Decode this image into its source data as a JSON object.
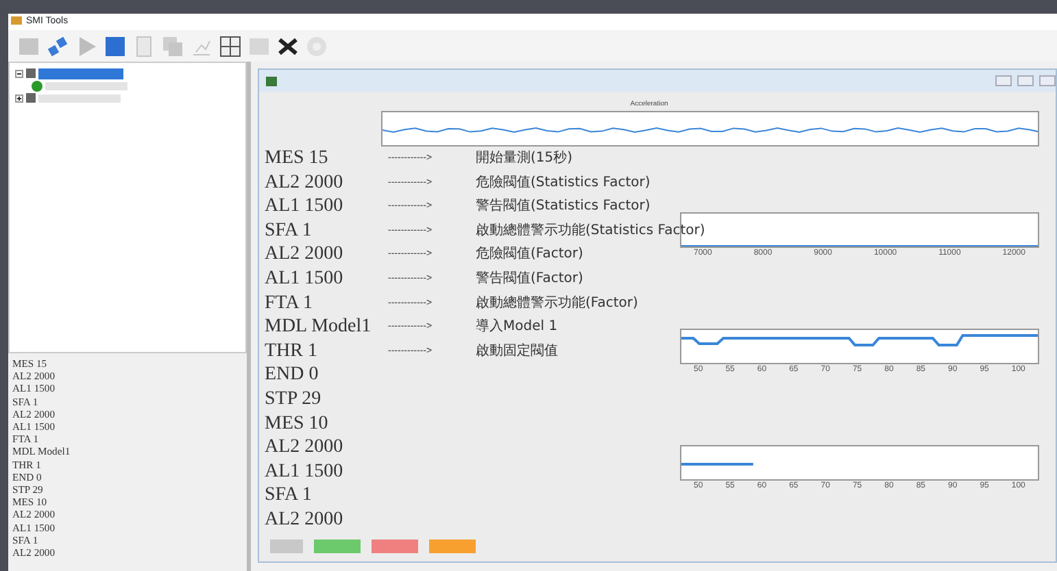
{
  "window": {
    "title": "SMI Tools"
  },
  "toolbar": [
    {
      "kind": "grid",
      "disabled": true
    },
    {
      "kind": "link",
      "disabled": false
    },
    {
      "kind": "play",
      "disabled": true
    },
    {
      "kind": "stop",
      "disabled": false
    },
    {
      "kind": "page",
      "disabled": true
    },
    {
      "kind": "copy",
      "disabled": true
    },
    {
      "kind": "chart",
      "disabled": true
    },
    {
      "kind": "layout",
      "disabled": false
    },
    {
      "kind": "save",
      "disabled": true
    },
    {
      "kind": "tools",
      "disabled": false
    },
    {
      "kind": "gear",
      "disabled": true
    }
  ],
  "tree": [
    {
      "selected": true,
      "expanded": true,
      "children": [
        {
          "selected": false,
          "kind": "ok"
        }
      ]
    },
    {
      "selected": false,
      "expanded": false
    }
  ],
  "console": [
    "MES 15",
    "AL2 2000",
    "AL1 1500",
    "SFA 1",
    "AL2 2000",
    "AL1 1500",
    "FTA 1",
    "MDL Model1",
    "THR 1",
    "END 0",
    "STP 29",
    "MES 10",
    "AL2 2000",
    "AL1 1500",
    "SFA 1",
    "AL2 2000"
  ],
  "commands": [
    {
      "code": "MES 15",
      "arrow": "------------>",
      "note": "開始量測(15秒)"
    },
    {
      "code": "AL2 2000",
      "arrow": "------------>",
      "note": "危險閥值(Statistics Factor)"
    },
    {
      "code": "AL1 1500",
      "arrow": "------------>",
      "note": "警告閥值(Statistics Factor)"
    },
    {
      "code": "SFA 1",
      "arrow": "------------>",
      "note": "啟動總體警示功能(Statistics Factor)"
    },
    {
      "code": "AL2 2000",
      "arrow": "------------>",
      "note": "危險閥值(Factor)"
    },
    {
      "code": "AL1 1500",
      "arrow": "------------>",
      "note": "警告閥值(Factor)"
    },
    {
      "code": "FTA 1",
      "arrow": "------------>",
      "note": "啟動總體警示功能(Factor)"
    },
    {
      "code": "MDL Model1",
      "arrow": "------------>",
      "note": "導入Model 1"
    },
    {
      "code": "THR 1",
      "arrow": "------------>",
      "note": "啟動固定閥值"
    },
    {
      "code": "END 0"
    },
    {
      "code": "STP 29"
    },
    {
      "code": "MES 10"
    },
    {
      "code": "AL2 2000"
    },
    {
      "code": "AL1 1500"
    },
    {
      "code": "SFA 1"
    },
    {
      "code": "AL2 2000"
    }
  ],
  "charts": [
    {
      "kind": "wave",
      "title": "Acceleration"
    },
    {
      "kind": "flat",
      "xticks": [
        "7000",
        "8000",
        "9000",
        "10000",
        "11000",
        "12000"
      ]
    },
    {
      "kind": "dips",
      "xticks": [
        "50",
        "55",
        "60",
        "65",
        "70",
        "75",
        "80",
        "85",
        "90",
        "95",
        "100"
      ]
    },
    {
      "kind": "short",
      "xticks": [
        "50",
        "55",
        "60",
        "65",
        "70",
        "75",
        "80",
        "85",
        "90",
        "95",
        "100"
      ]
    }
  ],
  "status_boxes": [
    {
      "color": "#c8c8c8"
    },
    {
      "color": "#6cc96c"
    },
    {
      "color": "#f08080"
    },
    {
      "color": "#f7a030"
    }
  ]
}
